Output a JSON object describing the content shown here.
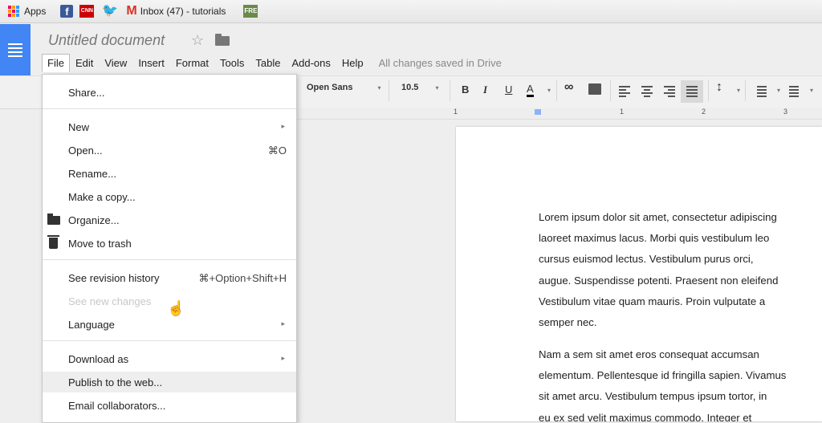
{
  "bookmarks": {
    "apps": "Apps",
    "facebook_glyph": "f",
    "cnn_glyph": "CNN",
    "twitter_glyph": "🐦",
    "gmail_glyph": "M",
    "inbox": "Inbox (47) - tutorials",
    "fr_glyph": "FRE"
  },
  "docs": {
    "title": "Untitled document",
    "star_glyph": "☆",
    "status": "All changes saved in Drive"
  },
  "menubar": [
    "File",
    "Edit",
    "View",
    "Insert",
    "Format",
    "Tools",
    "Table",
    "Add-ons",
    "Help"
  ],
  "toolbar": {
    "font": "Open Sans",
    "size": "10.5",
    "bold": "B",
    "italic": "I",
    "underline": "U",
    "text_color": "A",
    "link": "∞",
    "line_spacing": "↕",
    "caret": "▾"
  },
  "ruler": [
    "1",
    "1",
    "2",
    "3"
  ],
  "file_menu": {
    "share": "Share...",
    "new": "New",
    "open": "Open...",
    "open_shortcut": "⌘O",
    "rename": "Rename...",
    "make_copy": "Make a copy...",
    "organize": "Organize...",
    "trash": "Move to trash",
    "revision": "See revision history",
    "revision_shortcut": "⌘+Option+Shift+H",
    "new_changes": "See new changes",
    "language": "Language",
    "download": "Download as",
    "publish": "Publish to the web...",
    "email": "Email collaborators...",
    "submenu_arrow": "▸"
  },
  "document": {
    "para1": [
      "Lorem ipsum dolor sit amet, consectetur adipiscing",
      "laoreet maximus lacus. Morbi quis vestibulum leo",
      "cursus euismod lectus. Vestibulum purus orci, ",
      "augue. Suspendisse potenti. Praesent non eleifend",
      "Vestibulum vitae quam mauris. Proin vulputate a",
      "semper nec."
    ],
    "para2": [
      "Nam a sem sit amet eros consequat accumsan",
      "elementum. Pellentesque id fringilla sapien. Vivamus",
      "sit amet arcu. Vestibulum tempus ipsum tortor, in",
      "eu ex sed velit maximus commodo. Integer et"
    ]
  },
  "colors": {
    "docs_blue": "#4285f4",
    "text_color_underline": "#000000"
  }
}
